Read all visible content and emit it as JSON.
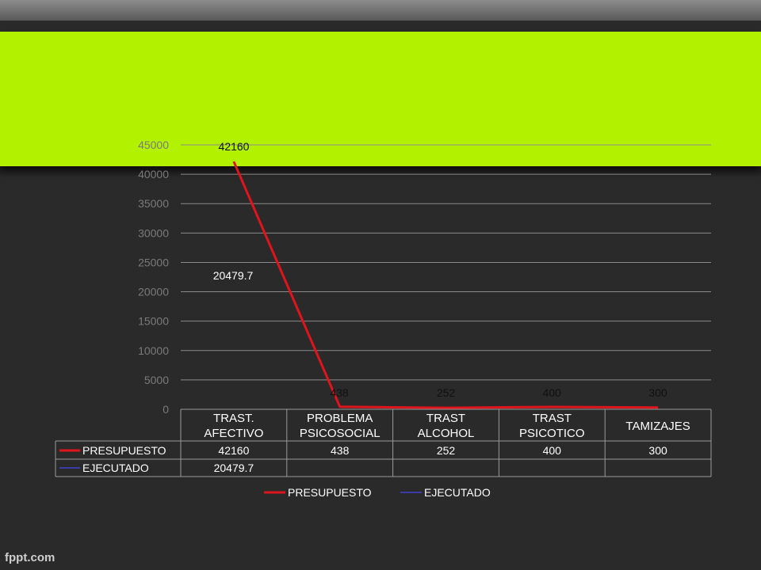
{
  "watermark": "fppt.com",
  "colors": {
    "green_bar": "#b2f200",
    "presupuesto": "#e0141c",
    "ejecutado": "#3c3ca8",
    "gridline": "#8a8a8a",
    "axis_text": "#7a7a7a",
    "table_text": "#ffffff"
  },
  "chart_data": {
    "type": "line",
    "categories": [
      [
        "TRAST.",
        "AFECTIVO"
      ],
      [
        "PROBLEMA",
        "PSICOSOCIAL"
      ],
      [
        "TRAST",
        "ALCOHOL"
      ],
      [
        "TRAST",
        "PSICOTICO"
      ],
      [
        "TAMIZAJES"
      ]
    ],
    "series": [
      {
        "name": "PRESUPUESTO",
        "values": [
          42160,
          438,
          252,
          400,
          300
        ],
        "color": "#e0141c"
      },
      {
        "name": "EJECUTADO",
        "values": [
          20479.7,
          null,
          null,
          null,
          null
        ],
        "color": "#3c3ca8"
      }
    ],
    "data_labels": {
      "PRESUPUESTO": [
        "42160",
        "438",
        "252",
        "400",
        "300"
      ],
      "EJECUTADO": [
        "20479.7",
        "",
        "",
        "",
        ""
      ]
    },
    "y_ticks": [
      "0",
      "5000",
      "10000",
      "15000",
      "20000",
      "25000",
      "30000",
      "35000",
      "40000",
      "45000"
    ],
    "ylim": [
      0,
      45000
    ],
    "grid": true,
    "legend_position": "bottom",
    "data_table": true
  }
}
